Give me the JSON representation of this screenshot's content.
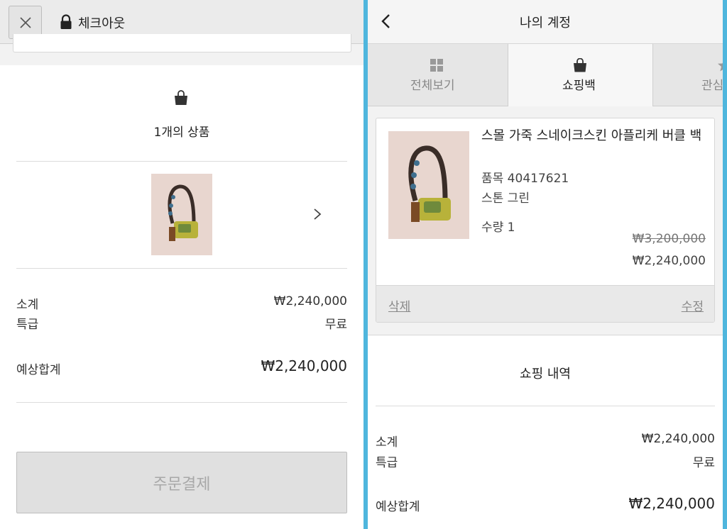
{
  "checkout": {
    "title": "체크아웃",
    "items_count": "1개의 상품",
    "subtotal_label": "소계",
    "subtotal_value": "₩2,240,000",
    "shipping_label": "특급",
    "shipping_value": "무료",
    "estimated_total_label": "예상합계",
    "estimated_total_value": "₩2,240,000",
    "checkout_button": "주문결제"
  },
  "account": {
    "title": "나의 계정",
    "tabs": [
      {
        "label": "전체보기",
        "icon": "grid-icon"
      },
      {
        "label": "쇼핑백",
        "icon": "bag-icon"
      },
      {
        "label": "관심",
        "icon": "star-icon"
      }
    ],
    "product": {
      "name": "스몰 가죽 스네이크스킨 아플리케 버클 백",
      "item_number": "품목 40417621",
      "color": "스톤 그린",
      "quantity": "수량 1",
      "original_price": "₩3,200,000",
      "sale_price": "₩2,240,000",
      "delete_label": "삭제",
      "edit_label": "수정"
    },
    "history": {
      "title": "쇼핑 내역",
      "subtotal_label": "소계",
      "subtotal_value": "₩2,240,000",
      "shipping_label": "특급",
      "shipping_value": "무료",
      "estimated_total_label": "예상합계",
      "estimated_total_value": "₩2,240,000"
    }
  },
  "colors": {
    "divider_accent": "#4fb6dd",
    "bag_thumb_bg": "#e5d3cc"
  }
}
